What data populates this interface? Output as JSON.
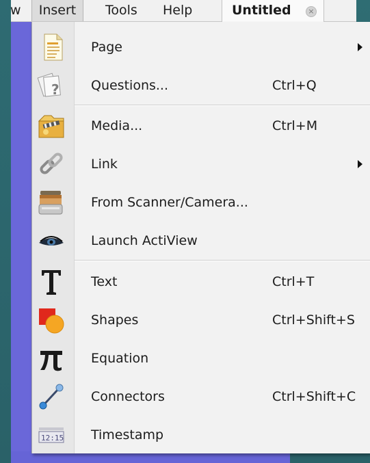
{
  "menubar": {
    "items": [
      {
        "label": "w",
        "active": false
      },
      {
        "label": "Insert",
        "active": true
      },
      {
        "label": "Tools",
        "active": false
      },
      {
        "label": "Help",
        "active": false
      }
    ],
    "document_tab": {
      "label": "Untitled",
      "close_glyph": "×"
    }
  },
  "insert_menu": {
    "items": [
      {
        "label": "Page",
        "shortcut": "",
        "submenu": true,
        "icon": "page-icon"
      },
      {
        "label": "Questions...",
        "shortcut": "Ctrl+Q",
        "submenu": false,
        "icon": "questions-icon"
      },
      {
        "label": "Media...",
        "shortcut": "Ctrl+M",
        "submenu": false,
        "icon": "media-icon"
      },
      {
        "label": "Link",
        "shortcut": "",
        "submenu": true,
        "icon": "link-icon"
      },
      {
        "label": "From Scanner/Camera...",
        "shortcut": "",
        "submenu": false,
        "icon": "scanner-icon"
      },
      {
        "label": "Launch ActiView",
        "shortcut": "",
        "submenu": false,
        "icon": "eye-icon"
      },
      {
        "label": "Text",
        "shortcut": "Ctrl+T",
        "submenu": false,
        "icon": "text-icon"
      },
      {
        "label": "Shapes",
        "shortcut": "Ctrl+Shift+S",
        "submenu": false,
        "icon": "shapes-icon"
      },
      {
        "label": "Equation",
        "shortcut": "",
        "submenu": false,
        "icon": "pi-icon"
      },
      {
        "label": "Connectors",
        "shortcut": "Ctrl+Shift+C",
        "submenu": false,
        "icon": "connector-icon"
      },
      {
        "label": "Timestamp",
        "shortcut": "",
        "submenu": false,
        "icon": "timestamp-icon"
      }
    ],
    "timestamp_icon_text": "12:15"
  },
  "colors": {
    "desktop": "#2f6a70",
    "canvas": "#6a67d9",
    "menu_background": "#f2f2f2",
    "icon_gutter": "#e7e7e7"
  }
}
